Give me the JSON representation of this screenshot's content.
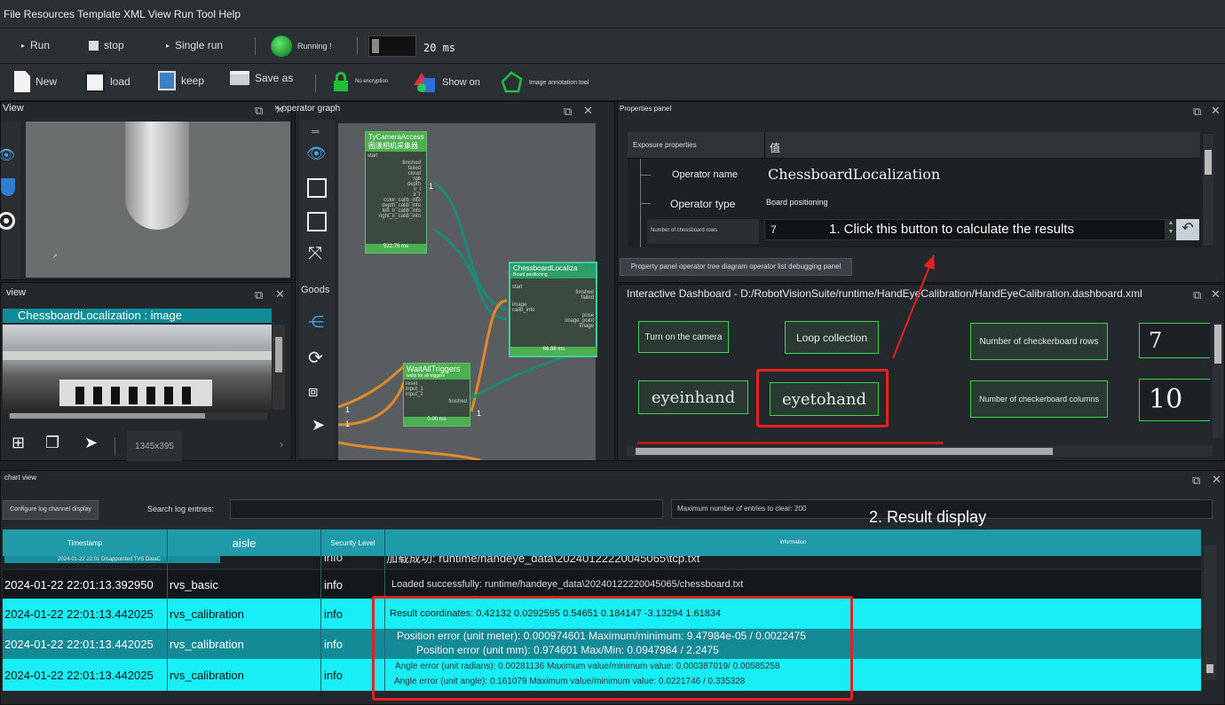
{
  "menubar": {
    "text": "File Resources Template XML View Run Tool Help"
  },
  "toolbar1": {
    "run_label": "Run",
    "stop_label": "stop",
    "single_run_label": "Single run",
    "running_label": "Running !",
    "interval_value": "20 ms"
  },
  "toolbar2": {
    "new_label": "New",
    "load_label": "load",
    "keep_label": "keep",
    "save_as_label": "Save as",
    "no_encryption_label": "No encryption",
    "show_on_label": "Show on",
    "annotation_label": "Image annotation tool"
  },
  "view_panel": {
    "title": "View"
  },
  "image_view": {
    "title": "view",
    "header": "ChessboardLocalization : image",
    "size_readout": "1345x395"
  },
  "operator_graph": {
    "title": "operator graph",
    "goods_label": "Goods",
    "node1": {
      "title": "TyCameraAccess",
      "subtitle": "图漾相机采集器",
      "time": "522.76 ms",
      "port_in": "start"
    },
    "node2": {
      "title": "ChessboardLocaliza",
      "subtitle": "Board positioning",
      "time": "66.86 ms"
    },
    "node3": {
      "title": "WaitAllTriggers",
      "subtitle": "waits for all triggers",
      "time": "0.00 ms",
      "port_out": "finished"
    },
    "ports1": [
      "finished",
      "failed",
      "cloud",
      "rgb",
      "depth",
      "ir_l",
      "ir_r",
      "color_calib_info",
      "depth_calib_info",
      "left_ir_calib_info",
      "right_ir_calib_info"
    ],
    "ports2_in": [
      "start",
      "image",
      "calib_info"
    ],
    "ports2_out": [
      "finished",
      "failed",
      "pose",
      "image_point",
      "image"
    ],
    "ports3_in": [
      "reset",
      "input_1",
      "input_2"
    ],
    "count_labels": [
      "1",
      "1",
      "1",
      "1"
    ]
  },
  "properties_panel": {
    "title": "Properties panel",
    "col1": "Exposure properties",
    "col2": "值",
    "rows": [
      {
        "name": "Operator name",
        "value": "ChessboardLocalization"
      },
      {
        "name": "Operator type",
        "value": "Board positioning"
      },
      {
        "name": "Number of chessboard rows",
        "value": "7"
      }
    ],
    "tabs": "Property panel operator tree diagram operator list debugging panel"
  },
  "annotation1": "1. Click this button to calculate the results",
  "annotation2": "2. Result display",
  "dashboard": {
    "title": "Interactive Dashboard - D:/RobotVisionSuite/runtime/HandEyeCalibration/HandEyeCalibration.dashboard.xml",
    "btn_camera": "Turn on the camera",
    "btn_loop": "Loop collection",
    "btn_eyeinhand": "eyeinhand",
    "btn_eyetohand": "eyetohand",
    "label_rows": "Number of checkerboard rows",
    "label_cols": "Number of checkerboard columns",
    "rows_value": "7",
    "cols_value": "10"
  },
  "chart_view": {
    "title": "chart view",
    "configure_btn": "Configure log channel display",
    "search_label": "Search log entries:",
    "max_label": "Maximum number of entries to clear: 200",
    "headers": {
      "timestamp": "Timestamp",
      "channel": "aisle",
      "level": "Security Level",
      "info": "information"
    },
    "overlay_row": {
      "ts": "2024-01-22 22:01  Disappointed TVS DataC",
      "level": "info",
      "info": "加载成功: runtime/handeye_data\\20240122220045065\\tcp.txt"
    },
    "rows": [
      {
        "ts": "2024-01-22 22:01:13.392950",
        "channel": "rvs_basic",
        "level": "info",
        "info": "Loaded successfully: runtime/handeye_data\\20240122220045065/chessboard.txt"
      },
      {
        "ts": "2024-01-22 22:01:13.442025",
        "channel": "rvs_calibration",
        "level": "info",
        "info": "Result coordinates: 0.42132 0.0292595 0.54651 0.184147 -3.13294 1.61834"
      },
      {
        "ts": "2024-01-22 22:01:13.442025",
        "channel": "rvs_calibration",
        "level": "info",
        "info": "Position error (unit meter): 0.000974601 Maximum/minimum: 9.47984e-05 / 0.0022475",
        "info2": "Position error (unit mm): 0.974601 Max/Min: 0.0947984 / 2.2475"
      },
      {
        "ts": "2024-01-22 22:01:13.442025",
        "channel": "rvs_calibration",
        "level": "info",
        "info": "Angle error (unit radians): 0.00281136 Maximum value/minimum value: 0.000387019/ 0.00585258",
        "info2": "Angle error (unit angle): 0.161079 Maximum value/minimum value: 0.0221746 / 0.335328"
      }
    ]
  }
}
